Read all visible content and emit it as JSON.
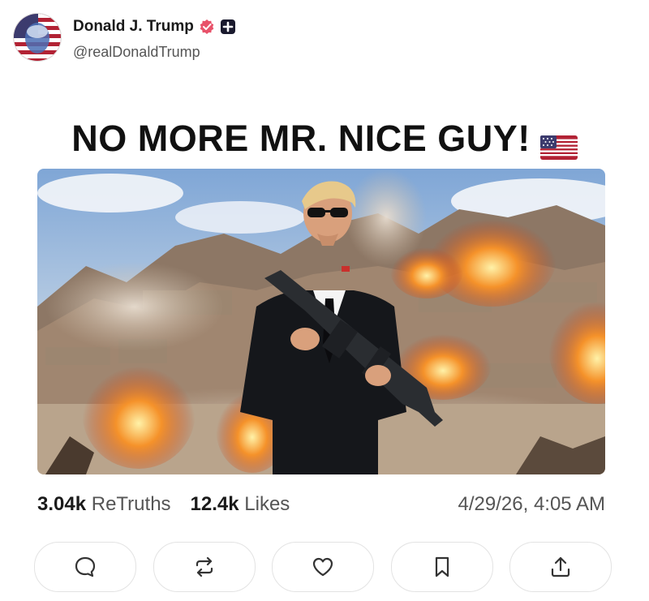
{
  "post": {
    "display_name": "Donald J. Trump",
    "handle": "@realDonaldTrump",
    "headline": "NO MORE MR. NICE GUY!",
    "headline_emoji": "us-flag-icon",
    "media_description_alt": "image"
  },
  "stats": {
    "retruths_count": "3.04k",
    "retruths_label": "ReTruths",
    "likes_count": "12.4k",
    "likes_label": "Likes",
    "timestamp": "4/29/26, 4:05 AM"
  },
  "actions": [
    {
      "name": "reply",
      "icon": "comment-icon"
    },
    {
      "name": "retruth",
      "icon": "repost-icon"
    },
    {
      "name": "like",
      "icon": "heart-icon"
    },
    {
      "name": "bookmark",
      "icon": "bookmark-icon"
    },
    {
      "name": "share",
      "icon": "share-icon"
    }
  ],
  "colors": {
    "verified": "#e8526a",
    "text_primary": "#1a1a1a",
    "text_secondary": "#555555",
    "button_border": "#e3e3e3"
  }
}
